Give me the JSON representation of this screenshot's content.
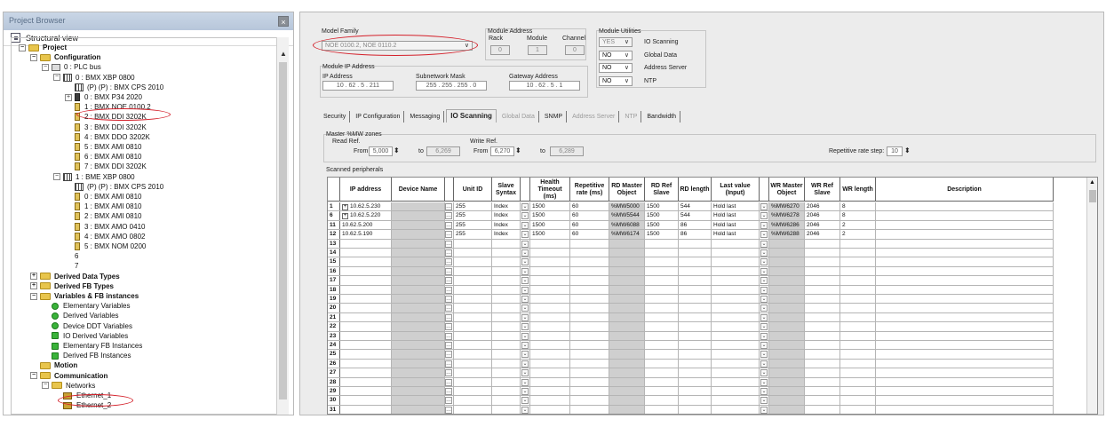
{
  "browser": {
    "title": "Project Browser",
    "close": "×",
    "view_label": "Structural view",
    "tree": [
      {
        "label": "Project",
        "level": 0,
        "bold": true,
        "icon": "folder",
        "expander": "−"
      },
      {
        "label": "Configuration",
        "level": 1,
        "bold": true,
        "icon": "folder",
        "expander": "−"
      },
      {
        "label": "0 : PLC bus",
        "level": 2,
        "icon": "bus",
        "expander": "−"
      },
      {
        "label": "0 : BMX XBP 0800",
        "level": 3,
        "icon": "rack",
        "expander": "−"
      },
      {
        "label": "(P) (P) : BMX CPS 2010",
        "level": 4,
        "icon": "rack"
      },
      {
        "label": "0 : BMX P34 2020",
        "level": 4,
        "icon": "mod-dark",
        "expander": "+"
      },
      {
        "label": "1 : BMX NOE 0100.2",
        "level": 4,
        "icon": "mod"
      },
      {
        "label": "2 : BMX DDI 3202K",
        "level": 4,
        "icon": "mod"
      },
      {
        "label": "3 : BMX DDI 3202K",
        "level": 4,
        "icon": "mod"
      },
      {
        "label": "4 : BMX DDO 3202K",
        "level": 4,
        "icon": "mod"
      },
      {
        "label": "5 : BMX AMI 0810",
        "level": 4,
        "icon": "mod"
      },
      {
        "label": "6 : BMX AMI 0810",
        "level": 4,
        "icon": "mod"
      },
      {
        "label": "7 : BMX DDI 3202K",
        "level": 4,
        "icon": "mod"
      },
      {
        "label": "1 : BME XBP 0800",
        "level": 3,
        "icon": "rack",
        "expander": "−"
      },
      {
        "label": "(P) (P) : BMX CPS 2010",
        "level": 4,
        "icon": "rack"
      },
      {
        "label": "0 : BMX AMI 0810",
        "level": 4,
        "icon": "mod"
      },
      {
        "label": "1 : BMX AMI 0810",
        "level": 4,
        "icon": "mod"
      },
      {
        "label": "2 : BMX AMI 0810",
        "level": 4,
        "icon": "mod"
      },
      {
        "label": "3 : BMX AMO 0410",
        "level": 4,
        "icon": "mod"
      },
      {
        "label": "4 : BMX AMO 0802",
        "level": 4,
        "icon": "mod"
      },
      {
        "label": "5 : BMX NOM 0200",
        "level": 4,
        "icon": "mod"
      },
      {
        "label": "6",
        "level": 4,
        "icon": "none"
      },
      {
        "label": "7",
        "level": 4,
        "icon": "none"
      },
      {
        "label": "Derived Data Types",
        "level": 1,
        "bold": true,
        "icon": "folder",
        "expander": "+"
      },
      {
        "label": "Derived FB Types",
        "level": 1,
        "bold": true,
        "icon": "folder",
        "expander": "+"
      },
      {
        "label": "Variables & FB instances",
        "level": 1,
        "bold": true,
        "icon": "folder",
        "expander": "−"
      },
      {
        "label": "Elementary Variables",
        "level": 2,
        "icon": "var"
      },
      {
        "label": "Derived Variables",
        "level": 2,
        "icon": "var"
      },
      {
        "label": "Device DDT Variables",
        "level": 2,
        "icon": "var"
      },
      {
        "label": "IO Derived Variables",
        "level": 2,
        "icon": "var-sq"
      },
      {
        "label": "Elementary FB Instances",
        "level": 2,
        "icon": "var-sq"
      },
      {
        "label": "Derived FB Instances",
        "level": 2,
        "icon": "var-sq"
      },
      {
        "label": "Motion",
        "level": 1,
        "bold": true,
        "icon": "folder"
      },
      {
        "label": "Communication",
        "level": 1,
        "bold": true,
        "icon": "folder",
        "expander": "−"
      },
      {
        "label": "Networks",
        "level": 2,
        "icon": "folder",
        "expander": "−"
      },
      {
        "label": "Ethernet_1",
        "level": 3,
        "icon": "net"
      },
      {
        "label": "Ethernet_2",
        "level": 3,
        "icon": "net"
      }
    ]
  },
  "config": {
    "model_family_label": "Model Family",
    "model_family_value": "NOE 0100.2, NOE 0110.2",
    "module_address_label": "Module Address",
    "rack_label": "Rack",
    "module_label": "Module",
    "channel_label": "Channel",
    "rack_value": "0",
    "module_value": "1",
    "channel_value": "0",
    "ip_group_label": "Module IP Address",
    "ip_label": "IP Address",
    "ip_value": "10 . 62 . 5 . 211",
    "mask_label": "Subnetwork Mask",
    "mask_value": "255 . 255 . 255 . 0",
    "gateway_label": "Gateway Address",
    "gateway_value": "10 . 62 . 5 . 1",
    "utilities_label": "Module Utilities",
    "utilities": [
      {
        "value": "YES",
        "label": "IO Scanning",
        "disabled": true
      },
      {
        "value": "NO",
        "label": "Global Data"
      },
      {
        "value": "NO",
        "label": "Address Server"
      },
      {
        "value": "NO",
        "label": "NTP"
      }
    ]
  },
  "tabs": [
    {
      "label": "Security"
    },
    {
      "label": "IP Configuration"
    },
    {
      "label": "Messaging"
    },
    {
      "label": "IO Scanning",
      "active": true
    },
    {
      "label": "Global Data",
      "disabled": true
    },
    {
      "label": "SNMP"
    },
    {
      "label": "Address Server",
      "disabled": true
    },
    {
      "label": "NTP",
      "disabled": true
    },
    {
      "label": "Bandwidth"
    }
  ],
  "scanning": {
    "master_zones_label": "Master %MW zones",
    "read_ref_label": "Read Ref.",
    "write_ref_label": "Write Ref.",
    "from_label": "From",
    "to_label": "to",
    "read_from": "5,000",
    "read_to": "6,269",
    "write_from": "6,270",
    "write_to": "6,289",
    "rate_step_label": "Repetitive rate step:",
    "rate_step": "10",
    "scanned_label": "Scanned peripherals"
  },
  "table": {
    "headers": [
      "",
      "IP address",
      "Device Name",
      "",
      "Unit ID",
      "Slave Syntax",
      "",
      "Health Timeout (ms)",
      "Repetitive rate (ms)",
      "RD Master Object",
      "RD Ref Slave",
      "RD length",
      "Last value (Input)",
      "",
      "WR Master Object",
      "WR Ref Slave",
      "WR length",
      "Description"
    ],
    "rows": [
      [
        "1",
        "10.62.5.230",
        "",
        "",
        "255",
        "Index",
        "",
        "1500",
        "60",
        "%MW5000",
        "1500",
        "544",
        "Hold last",
        "",
        "%MW6270",
        "2046",
        "8",
        ""
      ],
      [
        "6",
        "10.62.5.220",
        "",
        "",
        "255",
        "Index",
        "",
        "1500",
        "60",
        "%MW5544",
        "1500",
        "544",
        "Hold last",
        "",
        "%MW6278",
        "2046",
        "8",
        ""
      ],
      [
        "11",
        "10.62.5.200",
        "",
        "",
        "255",
        "Index",
        "",
        "1500",
        "60",
        "%MW6088",
        "1500",
        "86",
        "Hold last",
        "",
        "%MW6286",
        "2046",
        "2",
        ""
      ],
      [
        "12",
        "10.62.5.190",
        "",
        "",
        "255",
        "Index",
        "",
        "1500",
        "60",
        "%MW6174",
        "1500",
        "86",
        "Hold last",
        "",
        "%MW6288",
        "2046",
        "2",
        ""
      ],
      [
        "13"
      ],
      [
        "14"
      ],
      [
        "15"
      ],
      [
        "16"
      ],
      [
        "17"
      ],
      [
        "18"
      ],
      [
        "19"
      ],
      [
        "20"
      ],
      [
        "21"
      ],
      [
        "22"
      ],
      [
        "23"
      ],
      [
        "24"
      ],
      [
        "25"
      ],
      [
        "26"
      ],
      [
        "27"
      ],
      [
        "28"
      ],
      [
        "29"
      ],
      [
        "30"
      ],
      [
        "31"
      ]
    ],
    "expandable_rows": [
      "1",
      "6"
    ]
  }
}
